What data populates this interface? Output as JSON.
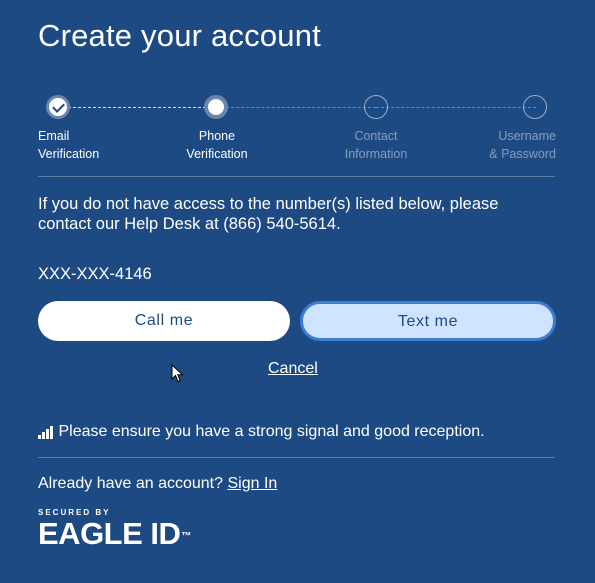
{
  "page": {
    "title": "Create your account"
  },
  "stepper": {
    "steps": [
      {
        "line1": "Email",
        "line2": "Verification",
        "state": "done"
      },
      {
        "line1": "Phone",
        "line2": "Verification",
        "state": "current"
      },
      {
        "line1": "Contact",
        "line2": "Information",
        "state": "todo"
      },
      {
        "line1": "Username",
        "line2": "& Password",
        "state": "todo"
      }
    ]
  },
  "main": {
    "info_text": "If you do not have access to the number(s) listed below, please contact our Help Desk at (866) 540-5614.",
    "phone_number": "XXX-XXX-4146",
    "call_label": "Call me",
    "text_label": "Text me",
    "cancel_label": "Cancel",
    "signal_note": "Please ensure you have a strong signal and good reception."
  },
  "footer": {
    "account_prompt": "Already have an account?",
    "signin_label": "Sign In",
    "brand_secured": "SECURED BY",
    "brand_name": "EAGLE ID",
    "brand_tm": "™"
  },
  "colors": {
    "background": "#1e4a83",
    "text_button_bg": "#cfe4ff",
    "text_button_border": "#3b7fd1"
  }
}
